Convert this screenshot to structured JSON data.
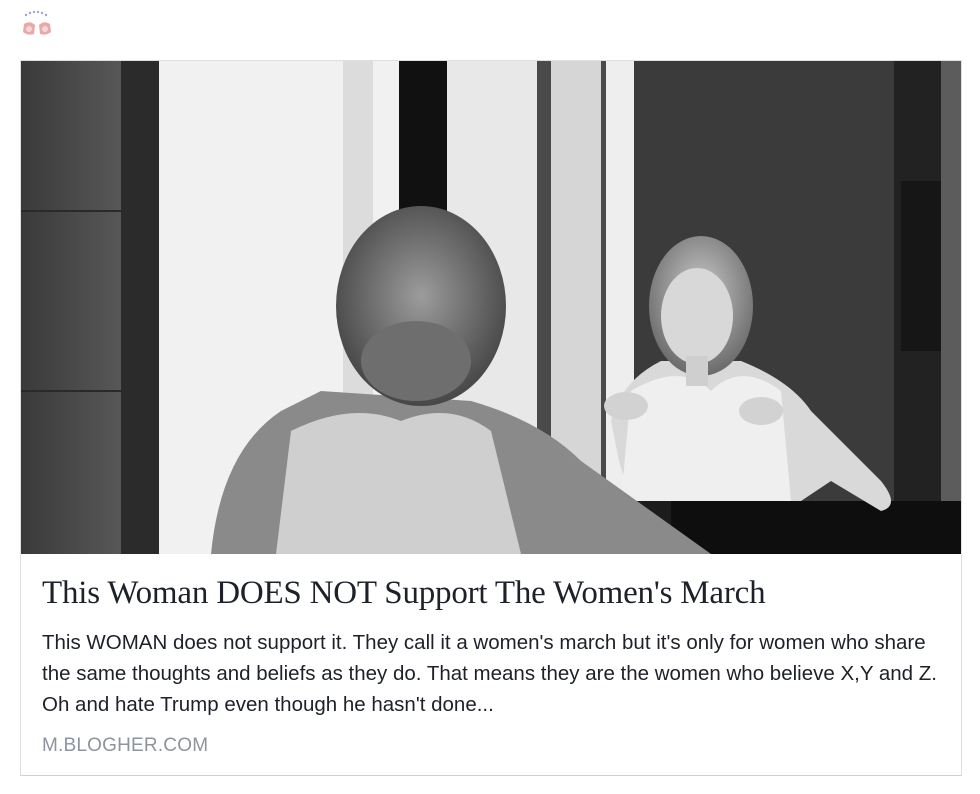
{
  "post": {
    "logo_icon": "blogher-logo-icon",
    "image_alt": "Black and white photo of a woman looking into a mirror adjusting her tank top",
    "title": "This Woman DOES NOT Support The Women's March",
    "description": "This WOMAN does not support it. They call it a women's march but it's only for women who share the same thoughts and beliefs as they do. That means they are the women who believe X,Y and Z. Oh and hate Trump even though he hasn't done...",
    "domain": "M.BLOGHER.COM"
  }
}
